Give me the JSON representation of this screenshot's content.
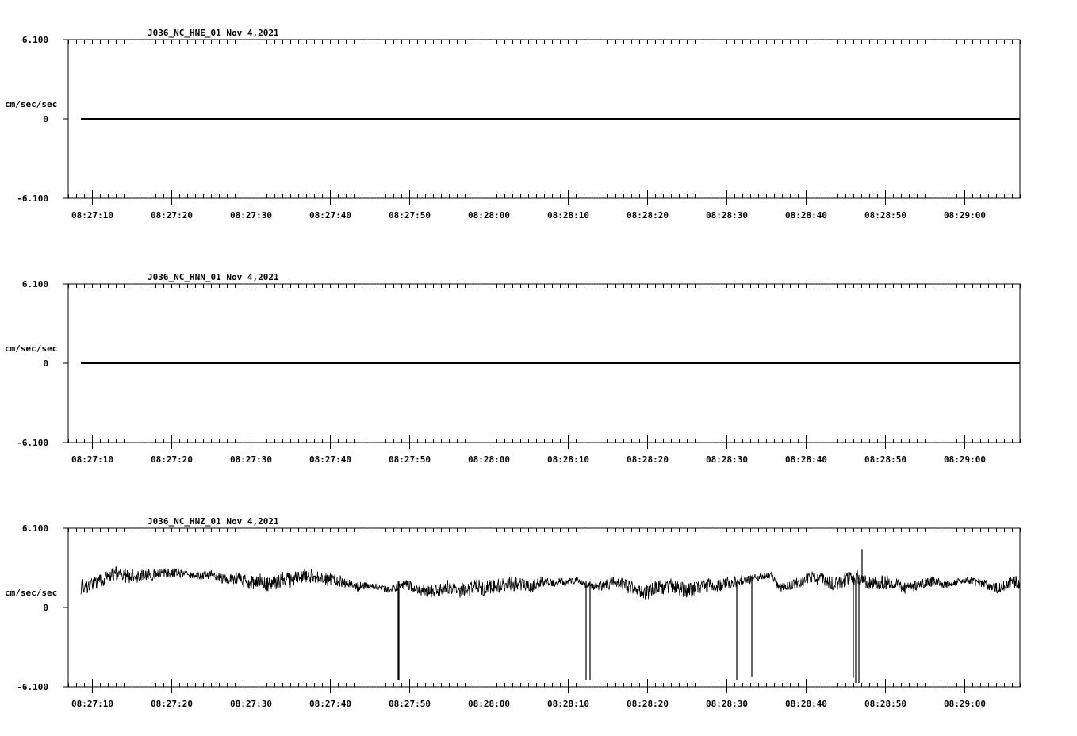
{
  "colors": {
    "background": "#ffffff",
    "ink": "#000000"
  },
  "chart_data": [
    {
      "type": "line",
      "title": "J036_NC_HNE_01   Nov 4,2021",
      "ylabel": "cm/sec/sec",
      "ylim": [
        -6.1,
        6.1
      ],
      "yticks": [
        6.1,
        0,
        -6.1
      ],
      "ytick_labels": [
        "6.100",
        "0",
        "-6.100"
      ],
      "xlim": [
        "08:27:07",
        "08:29:07"
      ],
      "xtick_labels": [
        "08:27:10",
        "08:27:20",
        "08:27:30",
        "08:27:40",
        "08:27:50",
        "08:28:00",
        "08:28:10",
        "08:28:20",
        "08:28:30",
        "08:28:40",
        "08:28:50",
        "08:29:00"
      ],
      "series": [
        {
          "x_start": "08:27:08.6",
          "x_end": "08:29:07",
          "values": [
            0.0,
            0.0
          ]
        }
      ]
    },
    {
      "type": "line",
      "title": "J036_NC_HNN_01   Nov 4,2021",
      "ylabel": "cm/sec/sec",
      "ylim": [
        -6.1,
        6.1
      ],
      "yticks": [
        6.1,
        0,
        -6.1
      ],
      "ytick_labels": [
        "6.100",
        "0",
        "-6.100"
      ],
      "xlim": [
        "08:27:07",
        "08:29:07"
      ],
      "xtick_labels": [
        "08:27:10",
        "08:27:20",
        "08:27:30",
        "08:27:40",
        "08:27:50",
        "08:28:00",
        "08:28:10",
        "08:28:20",
        "08:28:30",
        "08:28:40",
        "08:28:50",
        "08:29:00"
      ],
      "series": [
        {
          "x_start": "08:27:08.6",
          "x_end": "08:29:07",
          "values": [
            0.0,
            0.0
          ]
        }
      ]
    },
    {
      "type": "line",
      "title": "J036_NC_HNZ_01   Nov 4,2021",
      "ylabel": "cm/sec/sec",
      "ylim": [
        -6.1,
        6.1
      ],
      "yticks": [
        6.1,
        0,
        -6.1
      ],
      "ytick_labels": [
        "6.100",
        "0",
        "-6.100"
      ],
      "xlim": [
        "08:27:07",
        "08:29:07"
      ],
      "xtick_labels": [
        "08:27:10",
        "08:27:20",
        "08:27:30",
        "08:27:40",
        "08:27:50",
        "08:28:00",
        "08:28:10",
        "08:28:20",
        "08:28:30",
        "08:28:40",
        "08:28:50",
        "08:29:00"
      ],
      "series": [
        {
          "x_start": "08:27:08.6",
          "x_end": "08:29:07",
          "values": [
            1.6,
            1.7,
            1.8,
            2.2,
            2.5,
            2.6,
            2.4,
            2.4,
            2.5,
            2.5,
            2.6,
            2.6,
            2.7,
            2.6,
            2.5,
            2.4,
            2.5,
            2.6,
            2.3,
            2.1,
            2.3,
            2.0,
            1.9,
            2.1,
            1.8,
            1.9,
            2.2,
            2.1,
            2.3,
            2.5,
            2.4,
            2.1,
            2.2,
            2.0,
            2.0,
            1.7,
            1.6,
            1.6,
            1.7,
            1.4,
            1.4,
            1.6,
            1.8,
            1.5,
            1.3,
            1.2,
            1.4,
            1.6,
            1.5,
            1.3,
            1.3,
            1.6,
            1.5,
            1.6,
            1.7,
            1.9,
            1.8,
            1.7,
            1.6,
            1.9,
            2.0,
            1.9,
            2.0,
            2.0,
            2.1,
            1.8,
            1.7,
            1.6,
            1.8,
            2.0,
            1.7,
            1.5,
            1.3,
            1.2,
            1.4,
            1.6,
            1.7,
            1.5,
            1.3,
            1.4,
            1.6,
            1.7,
            1.6,
            1.9,
            1.9,
            2.1,
            2.1,
            2.3,
            2.4,
            2.5,
            1.5,
            1.6,
            1.9,
            2.0,
            2.4,
            2.2,
            2.1,
            1.8,
            1.9,
            2.2,
            2.3,
            2.0,
            1.8,
            1.9,
            2.0,
            1.7,
            1.5,
            1.7,
            1.8,
            1.9,
            2.0,
            1.8,
            1.7,
            2.0,
            2.1,
            2.0,
            1.8,
            1.7,
            1.5,
            1.6,
            2.0,
            1.9
          ]
        }
      ],
      "spikes": [
        {
          "x": "08:27:48.6",
          "y": -5.6
        },
        {
          "x": "08:27:48.7",
          "y": -5.6
        },
        {
          "x": "08:28:12.3",
          "y": -5.6
        },
        {
          "x": "08:28:12.8",
          "y": -5.6
        },
        {
          "x": "08:28:31.3",
          "y": -5.6
        },
        {
          "x": "08:28:33.2",
          "y": -5.3
        },
        {
          "x": "08:28:46.0",
          "y": -5.4
        },
        {
          "x": "08:28:46.3",
          "y": -5.8
        },
        {
          "x": "08:28:46.7",
          "y": -5.8
        },
        {
          "x": "08:28:47.1",
          "y": 4.5
        }
      ]
    }
  ]
}
